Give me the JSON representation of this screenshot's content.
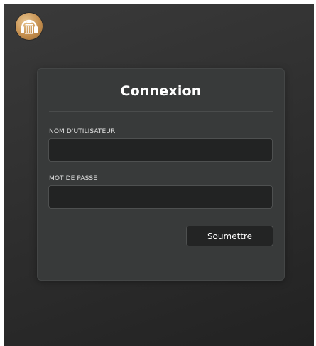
{
  "app": {
    "logo_icon": "headphones-building-icon",
    "accent_color": "#c58f4f"
  },
  "login": {
    "title": "Connexion",
    "username_label": "NOM D'UTILISATEUR",
    "username_value": "",
    "password_label": "MOT DE PASSE",
    "password_value": "",
    "submit_label": "Soumettre"
  }
}
